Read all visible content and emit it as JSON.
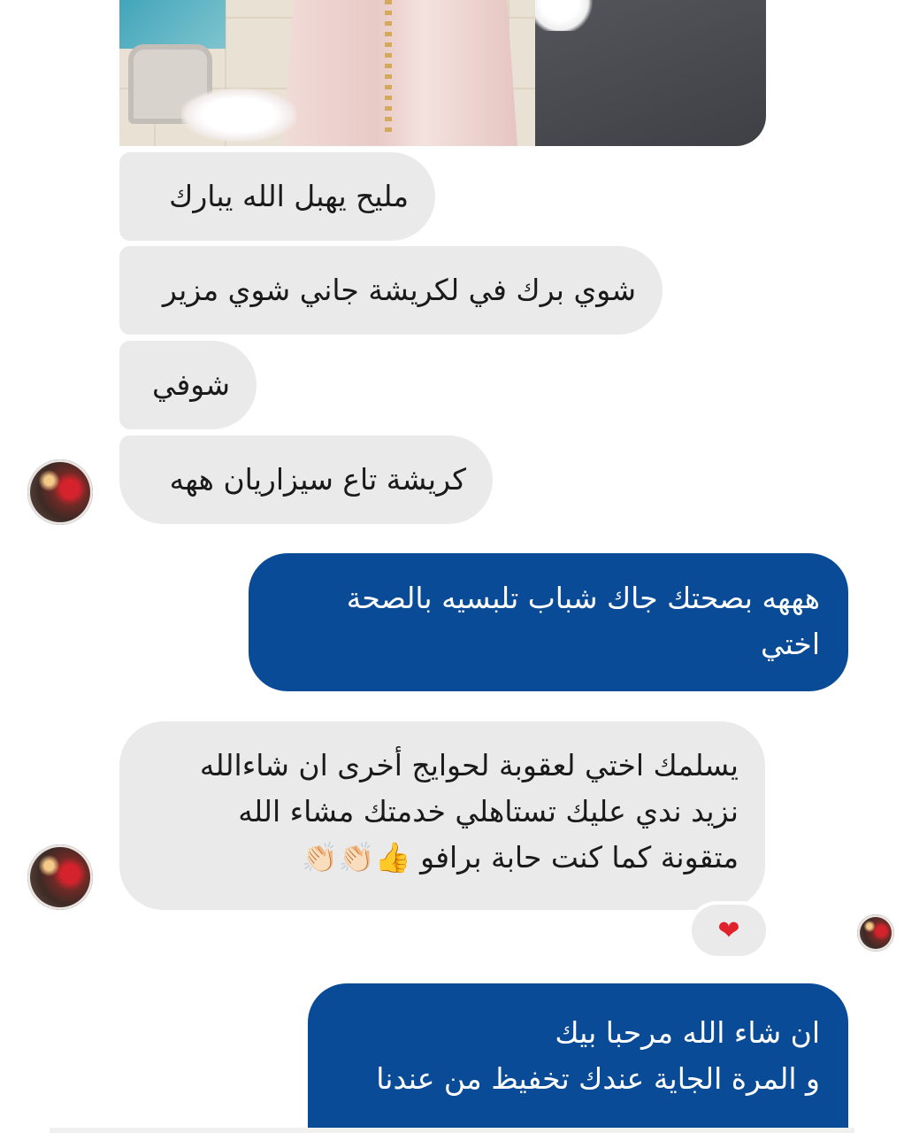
{
  "conversation": {
    "messages": [
      {
        "side": "incoming",
        "text": "مليح يهبل الله يبارك"
      },
      {
        "side": "incoming",
        "text": "شوي برك في لكريشة جاني شوي مزير"
      },
      {
        "side": "incoming",
        "text": "شوفي"
      },
      {
        "side": "incoming",
        "text": "كريشة تاع سيزاريان ههه"
      },
      {
        "side": "outgoing",
        "text": "هههه بصحتك جاك شباب تلبسيه بالصحة\nاختي"
      },
      {
        "side": "incoming",
        "text": "يسلمك اختي لعقوبة لحوايج أخرى ان شاءالله\nنزيد ندي عليك تستاهلي خدمتك مشاء الله\nمتقونة كما كنت حابة برافو 👍👏🏻👏🏻"
      },
      {
        "side": "outgoing",
        "text": "ان شاء الله مرحبا بيك\nو المرة الجاية عندك تخفيظ من عندنا"
      }
    ],
    "reaction": "❤"
  },
  "colors": {
    "incoming_bubble": "#eaeaea",
    "outgoing_bubble": "#0a4b97",
    "outgoing_text": "#ffffff",
    "incoming_text": "#1a1a1a"
  },
  "icons": {
    "reaction": "heart-icon",
    "avatar": "contact-avatar"
  }
}
